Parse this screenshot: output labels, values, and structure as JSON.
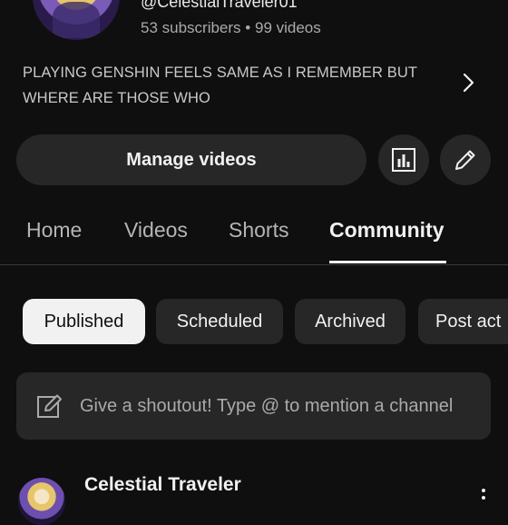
{
  "channel": {
    "handle": "@CelestialTraveler01",
    "subscribers": "53 subscribers",
    "separator": "•",
    "videos": "99 videos",
    "description": "PLAYING GENSHIN FEELS SAME AS I REMEMBER BUT WHERE ARE THOSE WHO"
  },
  "actions": {
    "manage_videos": "Manage videos",
    "analytics_icon": "bar-chart-icon",
    "edit_icon": "pencil-icon"
  },
  "tabs": [
    {
      "label": "Home",
      "active": false
    },
    {
      "label": "Videos",
      "active": false
    },
    {
      "label": "Shorts",
      "active": false
    },
    {
      "label": "Community",
      "active": true
    }
  ],
  "filters": [
    {
      "label": "Published",
      "selected": true
    },
    {
      "label": "Scheduled",
      "selected": false
    },
    {
      "label": "Archived",
      "selected": false
    },
    {
      "label": "Post act",
      "selected": false
    }
  ],
  "composer": {
    "placeholder": "Give a shoutout! Type @ to mention a channel"
  },
  "post": {
    "author": "Celestial Traveler"
  },
  "colors": {
    "background": "#0f0f0f",
    "surface": "#272727",
    "text_primary": "#f1f1f1",
    "text_secondary": "#aaaaaa"
  }
}
